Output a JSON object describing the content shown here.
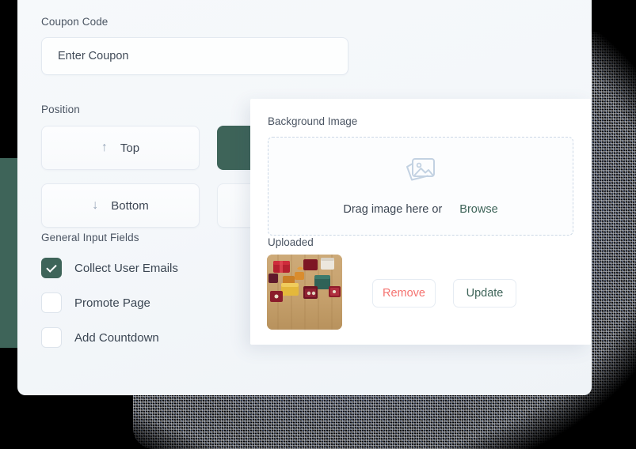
{
  "card": {
    "coupon": {
      "label": "Coupon Code",
      "placeholder": "Enter Coupon"
    },
    "position": {
      "label": "Position",
      "options": [
        {
          "label": "Top",
          "icon": "arrow-up-icon",
          "glyph": "↑",
          "selected": false
        },
        {
          "label": "",
          "icon": "arrow-up-icon",
          "glyph": "↑",
          "selected": true
        },
        {
          "label": "Bottom",
          "icon": "arrow-down-icon",
          "glyph": "↓",
          "selected": false
        },
        {
          "label": "",
          "icon": "arrow-down-icon",
          "glyph": "↓",
          "selected": false
        }
      ]
    },
    "general_input_fields": {
      "label": "General Input Fields",
      "items": [
        {
          "label": "Collect User Emails",
          "checked": true
        },
        {
          "label": "Promote Page",
          "checked": false
        },
        {
          "label": "Add Countdown",
          "checked": false
        }
      ]
    }
  },
  "overlay": {
    "title": "Background Image",
    "dropzone": {
      "icon": "image-stack-icon",
      "text": "Drag image here or",
      "browse_label": "Browse"
    },
    "uploaded": {
      "label": "Uploaded",
      "thumbnail_alt": "gift-boxes-on-wood-thumbnail",
      "remove_label": "Remove",
      "update_label": "Update"
    }
  },
  "colors": {
    "accent_green": "#3e6459",
    "danger_red": "#f5726f",
    "card_background": "#f4f7fa",
    "panel_background": "#ffffff",
    "label_text": "#4b5563"
  }
}
